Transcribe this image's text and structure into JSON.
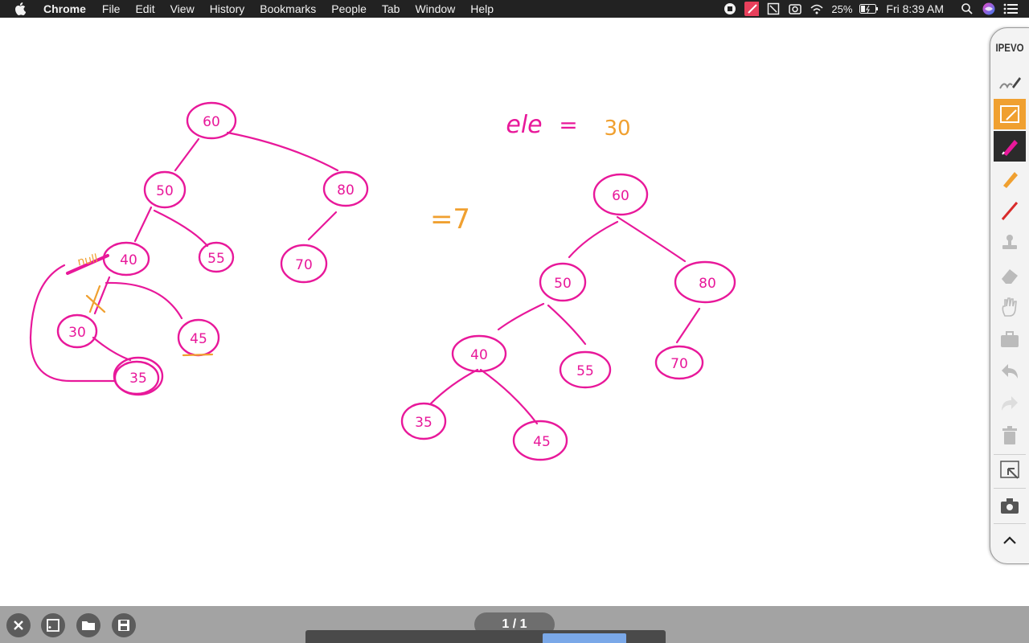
{
  "menubar": {
    "app_name": "Chrome",
    "menus": [
      "File",
      "Edit",
      "View",
      "History",
      "Bookmarks",
      "People",
      "Tab",
      "Window",
      "Help"
    ],
    "battery": "25%",
    "clock": "Fri 8:39 AM",
    "icons": [
      "apple-icon",
      "record-icon",
      "ipevo-annotate-icon",
      "crop-icon",
      "camera-icon",
      "wifi-icon",
      "battery-icon",
      "spotlight-search-icon",
      "siri-icon",
      "notification-center-icon"
    ]
  },
  "whiteboard": {
    "left_tree_nodes": [
      "60",
      "50",
      "80",
      "40",
      "55",
      "70",
      "30",
      "45",
      "35"
    ],
    "left_annotation": "null",
    "ele_label": "ele",
    "equals": "=",
    "ele_value": "30",
    "arrow": "=7",
    "right_tree_nodes": [
      "60",
      "50",
      "80",
      "40",
      "55",
      "70",
      "35",
      "45"
    ]
  },
  "toolbar": {
    "brand": "IPEVO",
    "tools": [
      "freehand-pen-icon",
      "capture-icon",
      "pen-icon",
      "highlighter-icon",
      "line-icon",
      "stamp-icon",
      "eraser-icon",
      "hand-icon",
      "toolbox-icon",
      "undo-icon",
      "redo-icon",
      "trash-icon",
      "select-icon",
      "camera-icon",
      "collapse-icon"
    ],
    "colors": {
      "pen": "#e91e8c",
      "orange": "#f0a030",
      "red": "#d92b2b"
    }
  },
  "bottombar": {
    "page_indicator": "1 / 1",
    "buttons": [
      "close-icon",
      "new-page-icon",
      "open-folder-icon",
      "save-icon"
    ]
  }
}
